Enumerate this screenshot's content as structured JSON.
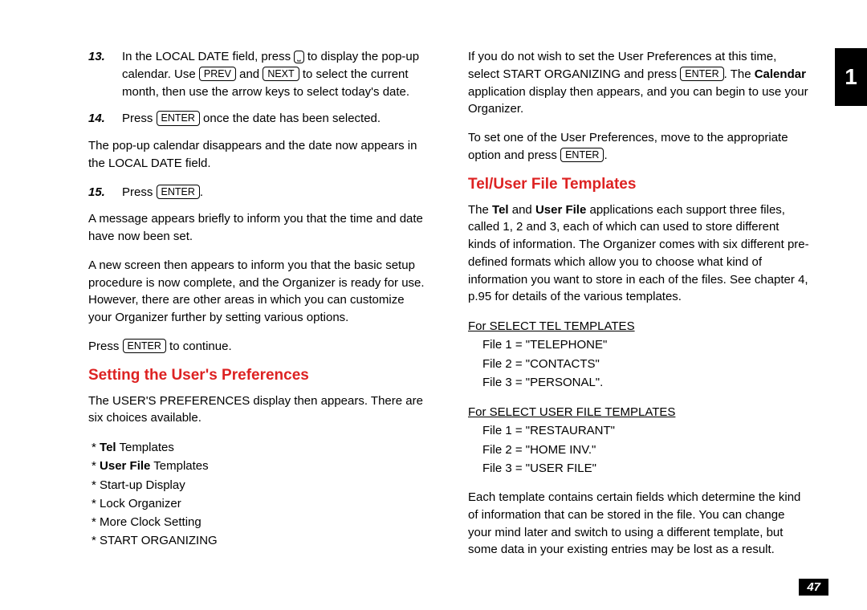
{
  "chapter_tab": "1",
  "page_number": "47",
  "keys": {
    "popup": "⎵",
    "prev": "PREV",
    "next": "NEXT",
    "enter": "ENTER"
  },
  "left": {
    "step13": {
      "num": "13.",
      "t1": "In the LOCAL DATE field, press ",
      "t2": " to display the pop-up calendar. Use ",
      "t3": " and ",
      "t4": " to select the current month, then use the arrow keys to select today's date."
    },
    "step14": {
      "num": "14.",
      "t1": "Press ",
      "t2": " once the date has been selected."
    },
    "after14": "The pop-up calendar disappears and the date now appears in the LOCAL DATE field.",
    "step15": {
      "num": "15.",
      "t1": "Press ",
      "t2": "."
    },
    "msg_set": "A message appears briefly to inform you that the time and date have now been set.",
    "new_screen": "A new screen then appears to inform you that the basic setup procedure is now complete, and the Organizer is ready for use. However, there are other areas in which you can customize your Organizer further by setting various options.",
    "press_continue_1": "Press ",
    "press_continue_2": " to continue.",
    "heading_prefs": "Setting the User's Preferences",
    "prefs_intro": "The USER'S PREFERENCES display then appears. There are six choices available.",
    "prefs": [
      {
        "star": "* ",
        "bold": "Tel",
        "rest": " Templates"
      },
      {
        "star": "* ",
        "bold": "User File",
        "rest": " Templates"
      },
      {
        "star": "* ",
        "bold": "",
        "rest": "Start-up Display"
      },
      {
        "star": "* ",
        "bold": "",
        "rest": "Lock Organizer"
      },
      {
        "star": "* ",
        "bold": "",
        "rest": "More Clock Setting"
      },
      {
        "star": "* ",
        "bold": "",
        "rest": "START ORGANIZING"
      }
    ]
  },
  "right": {
    "skip1": "If you do not wish to set the User Preferences at this time, select START ORGANIZING and press ",
    "skip2": ". The ",
    "skip_bold": "Calendar",
    "skip3": " application display then appears, and you can begin to use your Organizer.",
    "set1": "To set one of the User Preferences, move to the appropriate option and press ",
    "set2": ".",
    "heading_tpl": "Tel/User File Templates",
    "tpl_intro_1": "The ",
    "tpl_intro_b1": "Tel",
    "tpl_intro_2": " and ",
    "tpl_intro_b2": "User File",
    "tpl_intro_3": " applications each support three files, called 1, 2 and 3, each of which can used to store different kinds of information. The Organizer comes with six different pre-defined formats which allow you to choose what kind of information you want to store in each of the files. See chapter 4, p.95 for details of the various templates.",
    "tel_head": "For SELECT TEL TEMPLATES",
    "tel_files": [
      "File 1 = \"TELEPHONE\"",
      "File 2 = \"CONTACTS\"",
      "File 3 = \"PERSONAL\"."
    ],
    "user_head": "For SELECT USER FILE TEMPLATES",
    "user_files": [
      "File 1 = \"RESTAURANT\"",
      "File 2 = \"HOME INV.\"",
      "File 3 = \"USER FILE\""
    ],
    "tpl_note": "Each template contains certain fields which determine the kind of information that can be stored in the file. You can change your mind later and switch to using a different template, but some data in your existing entries may be lost as a result."
  }
}
